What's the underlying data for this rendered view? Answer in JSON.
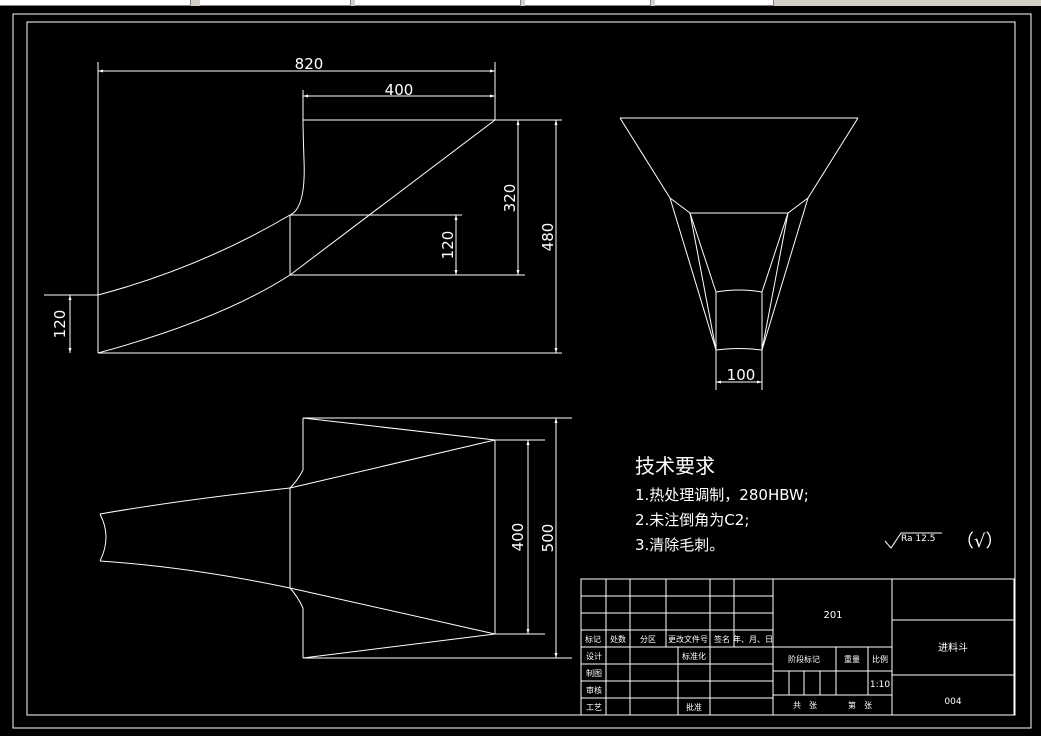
{
  "dimensions": {
    "top_overall": "820",
    "top_partial": "400",
    "top_height_inner": "320",
    "top_height_total": "480",
    "top_neck": "120",
    "top_left_height": "120",
    "side_bottom_width": "100",
    "bottom_inner": "400",
    "bottom_total": "500"
  },
  "tech_requirements": {
    "title": "技术要求",
    "items": [
      "1.热处理调制，280HBW;",
      "2.未注倒角为C2;",
      "3.清除毛刺。"
    ]
  },
  "roughness": {
    "value": "Ra 12.5",
    "other": "（√）"
  },
  "title_block": {
    "drawing_number": "201",
    "part_name": "进料斗",
    "code": "004",
    "scale": "1:10",
    "headers": [
      "标记",
      "处数",
      "分区",
      "更改文件号",
      "签名",
      "年、月、日"
    ],
    "rows": [
      "设计",
      "制图",
      "审核",
      "工艺"
    ],
    "standardization": "标准化",
    "approve": "批准",
    "stage_label": "阶段标记",
    "weight_label": "重量",
    "scale_label": "比例",
    "sheets_total": "共　张",
    "sheet_no": "第　张"
  },
  "colors": {
    "background": "#000000",
    "line": "#ffffff",
    "toolbar": "#d4d0c8"
  }
}
